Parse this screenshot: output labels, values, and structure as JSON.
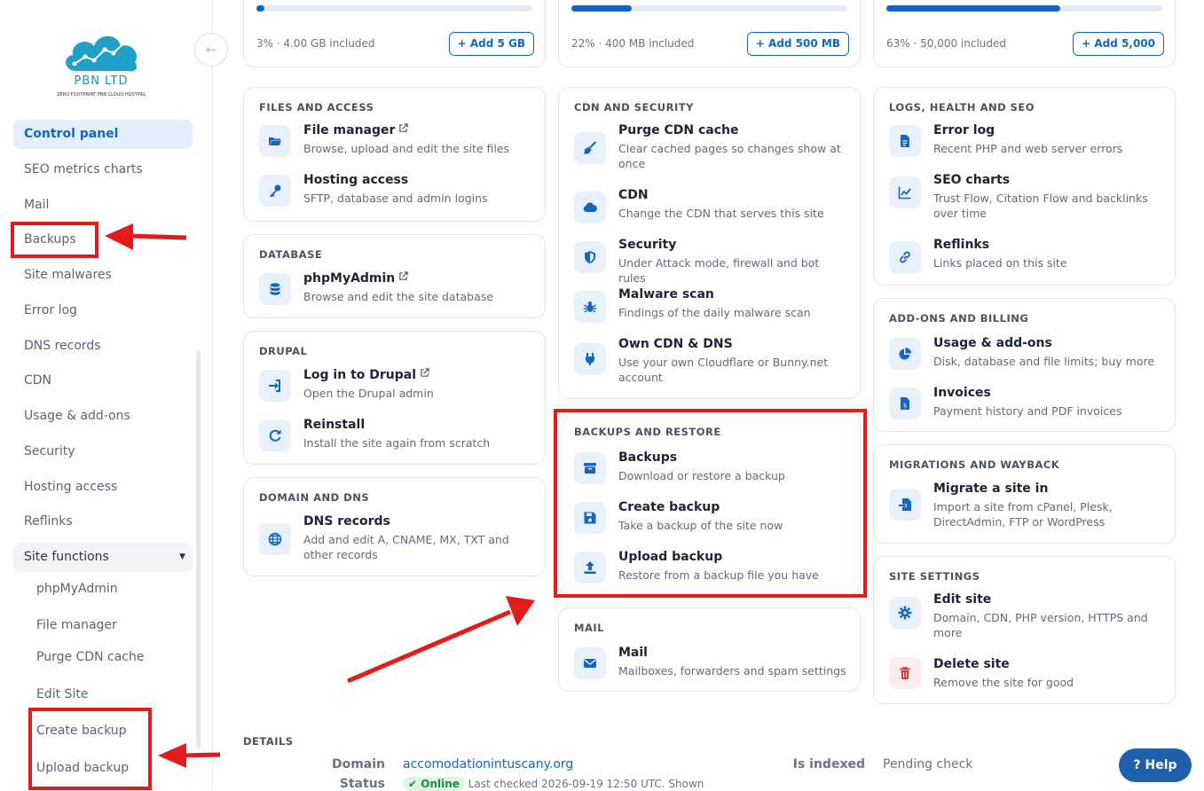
{
  "brand": {
    "name": "PBN LTD",
    "tagline": "ZERO FOOTPRINT PBN CLOUD HOSTING"
  },
  "sidebar": {
    "collapse_icon": "arrow-left-icon",
    "items": [
      {
        "label": "Control panel",
        "active": true
      },
      {
        "label": "SEO metrics charts"
      },
      {
        "label": "Mail"
      },
      {
        "label": "Backups"
      },
      {
        "label": "Site malwares"
      },
      {
        "label": "Error log"
      },
      {
        "label": "DNS records"
      },
      {
        "label": "CDN"
      },
      {
        "label": "Usage & add-ons"
      },
      {
        "label": "Security"
      },
      {
        "label": "Hosting access"
      },
      {
        "label": "Reflinks"
      }
    ],
    "site_functions": {
      "label": "Site functions",
      "items": [
        "phpMyAdmin",
        "File manager",
        "Purge CDN cache",
        "Edit Site",
        "Create backup",
        "Upload backup"
      ]
    }
  },
  "usage": [
    {
      "text": "3% · 4.00 GB included",
      "button": "+ Add 5 GB",
      "percent": 3
    },
    {
      "text": "22% · 400 MB included",
      "button": "+ Add 500 MB",
      "percent": 22
    },
    {
      "text": "63% · 50,000 included",
      "button": "+ Add 5,000",
      "percent": 63
    }
  ],
  "sections": {
    "files": {
      "title": "FILES AND ACCESS",
      "items": [
        {
          "title": "File manager",
          "desc": "Browse, upload and edit the site files",
          "icon": "folder-open-icon",
          "external": true
        },
        {
          "title": "Hosting access",
          "desc": "SFTP, database and admin logins",
          "icon": "key-icon"
        }
      ]
    },
    "database": {
      "title": "DATABASE",
      "items": [
        {
          "title": "phpMyAdmin",
          "desc": "Browse and edit the site database",
          "icon": "database-icon",
          "external": true
        }
      ]
    },
    "drupal": {
      "title": "DRUPAL",
      "items": [
        {
          "title": "Log in to Drupal",
          "desc": "Open the Drupal admin",
          "icon": "sign-in-icon",
          "external": true
        },
        {
          "title": "Reinstall",
          "desc": "Install the site again from scratch",
          "icon": "refresh-icon"
        }
      ]
    },
    "domain": {
      "title": "DOMAIN AND DNS",
      "items": [
        {
          "title": "DNS records",
          "desc": "Add and edit A, CNAME, MX, TXT and other records",
          "icon": "globe-icon"
        }
      ]
    },
    "cdn": {
      "title": "CDN AND SECURITY",
      "items": [
        {
          "title": "Purge CDN cache",
          "desc": "Clear cached pages so changes show at once",
          "icon": "broom-icon"
        },
        {
          "title": "CDN",
          "desc": "Change the CDN that serves this site",
          "icon": "cloud-icon"
        },
        {
          "title": "Security",
          "desc": "Under Attack mode, firewall and bot rules",
          "icon": "shield-icon"
        },
        {
          "title": "Malware scan",
          "desc": "Findings of the daily malware scan",
          "icon": "bug-icon"
        },
        {
          "title": "Own CDN & DNS",
          "desc": "Use your own Cloudflare or Bunny.net account",
          "icon": "plug-icon"
        }
      ]
    },
    "backups": {
      "title": "BACKUPS AND RESTORE",
      "items": [
        {
          "title": "Backups",
          "desc": "Download or restore a backup",
          "icon": "archive-icon"
        },
        {
          "title": "Create backup",
          "desc": "Take a backup of the site now",
          "icon": "save-icon"
        },
        {
          "title": "Upload backup",
          "desc": "Restore from a backup file you have",
          "icon": "upload-icon"
        }
      ]
    },
    "mail": {
      "title": "MAIL",
      "items": [
        {
          "title": "Mail",
          "desc": "Mailboxes, forwarders and spam settings",
          "icon": "envelope-icon"
        }
      ]
    },
    "logs": {
      "title": "LOGS, HEALTH AND SEO",
      "items": [
        {
          "title": "Error log",
          "desc": "Recent PHP and web server errors",
          "icon": "file-icon"
        },
        {
          "title": "SEO charts",
          "desc": "Trust Flow, Citation Flow and backlinks over time",
          "icon": "chart-line-icon"
        },
        {
          "title": "Reflinks",
          "desc": "Links placed on this site",
          "icon": "link-icon"
        }
      ]
    },
    "addons": {
      "title": "ADD-ONS AND BILLING",
      "items": [
        {
          "title": "Usage & add-ons",
          "desc": "Disk, database and file limits; buy more",
          "icon": "pie-chart-icon"
        },
        {
          "title": "Invoices",
          "desc": "Payment history and PDF invoices",
          "icon": "invoice-icon"
        }
      ]
    },
    "migrations": {
      "title": "MIGRATIONS AND WAYBACK",
      "items": [
        {
          "title": "Migrate a site in",
          "desc": "Import a site from cPanel, Plesk, DirectAdmin, FTP or WordPress",
          "icon": "file-import-icon"
        }
      ]
    },
    "settings": {
      "title": "SITE SETTINGS",
      "items": [
        {
          "title": "Edit site",
          "desc": "Domain, CDN, PHP version, HTTPS and more",
          "icon": "gear-icon"
        },
        {
          "title": "Delete site",
          "desc": "Remove the site for good",
          "icon": "trash-icon"
        }
      ]
    }
  },
  "details": {
    "title": "DETAILS",
    "domain_label": "Domain",
    "domain": "accomodationintuscany.org",
    "status_label": "Status",
    "status": "Online",
    "last_checked": "Last checked 2026-09-19 12:50 UTC. Shown",
    "indexed_label": "Is indexed",
    "indexed": "Pending check"
  },
  "help": "? Help",
  "colors": {
    "accent": "#1565c0",
    "annotation": "#e31b1b",
    "active_bg": "#e3efff"
  }
}
